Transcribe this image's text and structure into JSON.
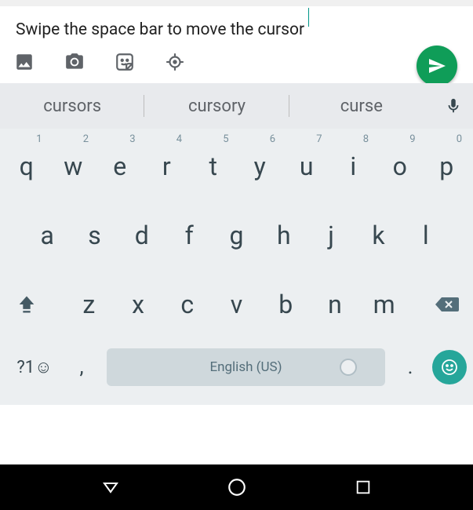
{
  "input": {
    "text": "Swipe the space bar to move the cursor",
    "cursor_after_index": 38
  },
  "suggestions": [
    "cursors",
    "cursory",
    "curse"
  ],
  "keyboard": {
    "row1": [
      {
        "label": "q",
        "num": "1"
      },
      {
        "label": "w",
        "num": "2"
      },
      {
        "label": "e",
        "num": "3"
      },
      {
        "label": "r",
        "num": "4"
      },
      {
        "label": "t",
        "num": "5"
      },
      {
        "label": "y",
        "num": "6"
      },
      {
        "label": "u",
        "num": "7"
      },
      {
        "label": "i",
        "num": "8"
      },
      {
        "label": "o",
        "num": "9"
      },
      {
        "label": "p",
        "num": "0"
      }
    ],
    "row2": [
      "a",
      "s",
      "d",
      "f",
      "g",
      "h",
      "j",
      "k",
      "l"
    ],
    "row3": [
      "z",
      "x",
      "c",
      "v",
      "b",
      "n",
      "m"
    ],
    "symbols_label": "?1☺",
    "comma_label": ",",
    "period_label": ".",
    "space_label": "English (US)"
  },
  "colors": {
    "send_green": "#0f9d58",
    "emoji_teal": "#26a69a"
  }
}
